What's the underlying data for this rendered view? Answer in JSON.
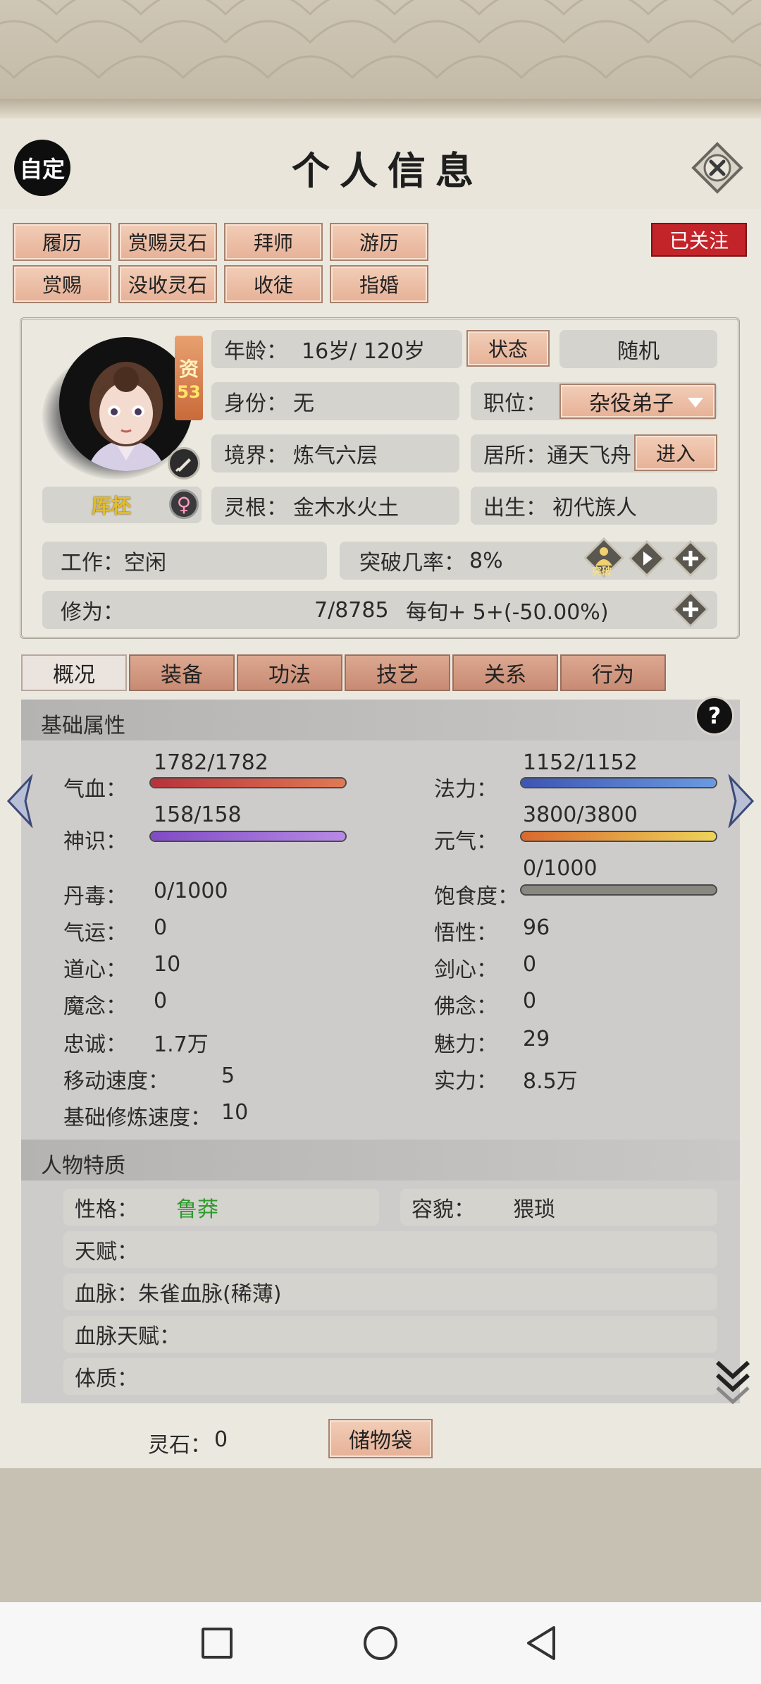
{
  "header": {
    "title": "个人信息",
    "auto_label": "自定"
  },
  "actions_row1": [
    "履历",
    "赏赐灵石",
    "拜师",
    "游历"
  ],
  "actions_row2": [
    "赏赐",
    "没收灵石",
    "收徒",
    "指婚"
  ],
  "follow_label": "已关注",
  "profile": {
    "aptitude_label": "资",
    "aptitude_value": "53",
    "name": "厍柸",
    "gender_symbol": "♀",
    "age_label": "年龄：",
    "age_value": "16岁/ 120岁",
    "status_button": "状态",
    "random_button": "随机",
    "identity_label": "身份：",
    "identity_value": "无",
    "position_label": "职位：",
    "position_value": "杂役弟子",
    "realm_label": "境界：",
    "realm_value": "炼气六层",
    "residence_label": "居所：",
    "residence_value": "通天飞舟",
    "enter_button": "进入",
    "root_label": "灵根：",
    "root_value": "金木水火土",
    "birth_label": "出生：",
    "birth_value": "初代族人",
    "job_label": "工作：",
    "job_value": "空闲",
    "breakthrough_label": "突破几率：",
    "breakthrough_value": "8%",
    "breakthrough_icon_text": "突破",
    "cultivation_label": "修为：",
    "cultivation_value": "7/8785",
    "cultivation_rate": "每旬+ 5+(-50.00%)"
  },
  "tabs": [
    "概况",
    "装备",
    "功法",
    "技艺",
    "关系",
    "行为"
  ],
  "section_basic": "基础属性",
  "help_symbol": "?",
  "stats_bars": [
    {
      "label": "气血：",
      "value": "1782/1782",
      "fill": 1.0,
      "color_from": "#b8313a",
      "color_to": "#e07a55"
    },
    {
      "label": "法力：",
      "value": "1152/1152",
      "fill": 1.0,
      "color_from": "#3d55b3",
      "color_to": "#6b9ae0"
    },
    {
      "label": "神识：",
      "value": "158/158",
      "fill": 1.0,
      "color_from": "#7f4bc4",
      "color_to": "#b78ae6"
    },
    {
      "label": "元气：",
      "value": "3800/3800",
      "fill": 1.0,
      "color_from": "#d9692e",
      "color_to": "#eed45a"
    },
    {
      "label": "饱食度：",
      "value": "0/1000",
      "fill": 0.0,
      "color_from": "#8a8780",
      "color_to": "#8a8780"
    }
  ],
  "stats_left": [
    {
      "label": "丹毒：",
      "value": "0/1000"
    },
    {
      "label": "气运：",
      "value": "0"
    },
    {
      "label": "道心：",
      "value": "10"
    },
    {
      "label": "魔念：",
      "value": "0"
    },
    {
      "label": "忠诚：",
      "value": "1.7万"
    },
    {
      "label": "移动速度：",
      "value": "5"
    },
    {
      "label": "基础修炼速度：",
      "value": "10"
    }
  ],
  "stats_right": [
    {
      "label": "悟性：",
      "value": "96"
    },
    {
      "label": "剑心：",
      "value": "0"
    },
    {
      "label": "佛念：",
      "value": "0"
    },
    {
      "label": "魅力：",
      "value": "29"
    },
    {
      "label": "实力：",
      "value": "8.5万"
    }
  ],
  "section_traits": "人物特质",
  "traits": {
    "personality_label": "性格：",
    "personality_value": "鲁莽",
    "looks_label": "容貌：",
    "looks_value": "猥琐",
    "talent_label": "天赋：",
    "bloodline_label": "血脉：",
    "bloodline_value": "朱雀血脉(稀薄)",
    "bloodline_talent_label": "血脉天赋：",
    "physique_label": "体质："
  },
  "footer": {
    "spirit_stone_label": "灵石：",
    "spirit_stone_value": "0",
    "storage_button": "储物袋"
  },
  "colors": {
    "accent_red": "#c0282d",
    "tab_active": "#ebe3de",
    "green_text": "#2e9a2e"
  }
}
